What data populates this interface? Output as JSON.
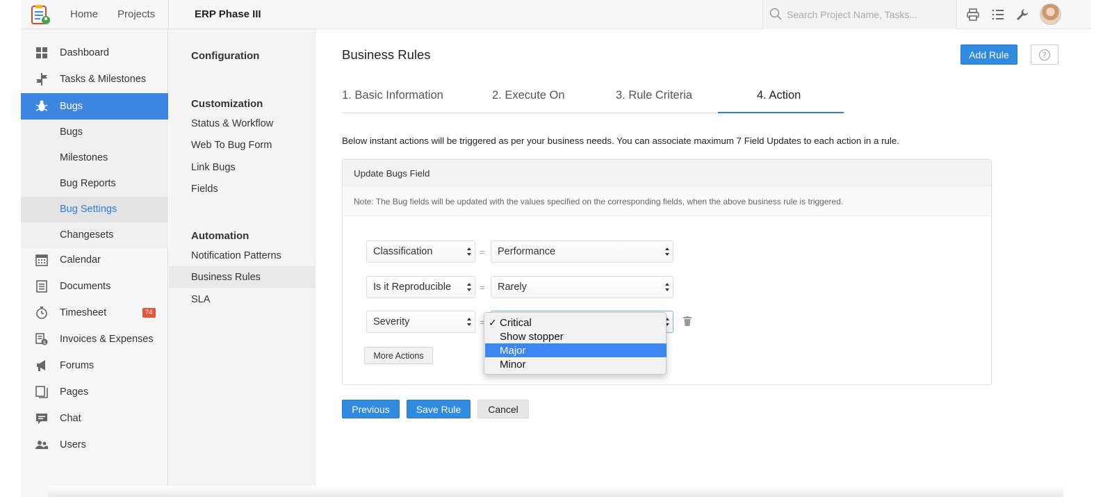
{
  "topbar": {
    "nav": [
      "Home",
      "Projects"
    ],
    "project_title": "ERP Phase III",
    "search_placeholder": "Search Project Name, Tasks...",
    "icons": [
      "print-icon",
      "list-icon",
      "wrench-icon",
      "user-avatar"
    ]
  },
  "sidebar": {
    "items": [
      {
        "label": "Dashboard",
        "icon": "dashboard-icon"
      },
      {
        "label": "Tasks & Milestones",
        "icon": "tasks-icon"
      },
      {
        "label": "Bugs",
        "icon": "bug-icon",
        "active": true
      },
      {
        "label": "Calendar",
        "icon": "calendar-icon"
      },
      {
        "label": "Documents",
        "icon": "documents-icon"
      },
      {
        "label": "Timesheet",
        "icon": "timer-icon",
        "badge": "74"
      },
      {
        "label": "Invoices & Expenses",
        "icon": "invoice-icon"
      },
      {
        "label": "Forums",
        "icon": "megaphone-icon"
      },
      {
        "label": "Pages",
        "icon": "pages-icon"
      },
      {
        "label": "Chat",
        "icon": "chat-icon"
      },
      {
        "label": "Users",
        "icon": "users-icon"
      }
    ],
    "bug_subitems": [
      "Bugs",
      "Milestones",
      "Bug Reports",
      "Bug Settings",
      "Changesets"
    ],
    "active_subitem": "Bug Settings"
  },
  "config": {
    "title": "Configuration",
    "customization_heading": "Customization",
    "customization_links": [
      "Status & Workflow",
      "Web To Bug Form",
      "Link Bugs",
      "Fields"
    ],
    "automation_heading": "Automation",
    "automation_links": [
      "Notification Patterns",
      "Business Rules",
      "SLA"
    ],
    "active_link": "Business Rules"
  },
  "main": {
    "title": "Business Rules",
    "add_rule_label": "Add Rule",
    "tabs": [
      "1. Basic Information",
      "2. Execute On",
      "3. Rule Criteria",
      "4. Action"
    ],
    "active_tab": "4. Action",
    "description": "Below instant actions will be triggered as per your business needs. You can associate maximum 7 Field Updates to each action in a rule.",
    "panel_title": "Update Bugs Field",
    "panel_note": "Note: The Bug fields will be updated with the values specified on the corresponding fields, when the above business rule is triggered.",
    "rules": [
      {
        "field": "Classification",
        "operator": "=",
        "value": "Performance"
      },
      {
        "field": "Is it Reproducible",
        "operator": "=",
        "value": "Rarely"
      },
      {
        "field": "Severity",
        "operator": "=",
        "value": "Critical"
      }
    ],
    "severity_options": [
      "Critical",
      "Show stopper",
      "Major",
      "Minor"
    ],
    "severity_checked": "Critical",
    "severity_highlighted": "Major",
    "check_mark": "✓",
    "more_actions_label": "More Actions",
    "previous_label": "Previous",
    "save_label": "Save Rule",
    "cancel_label": "Cancel"
  },
  "colors": {
    "accent": "#2f8ae0",
    "active_sidebar": "#3d86e0",
    "badge": "#e5573c",
    "highlight": "#3b86f0"
  }
}
